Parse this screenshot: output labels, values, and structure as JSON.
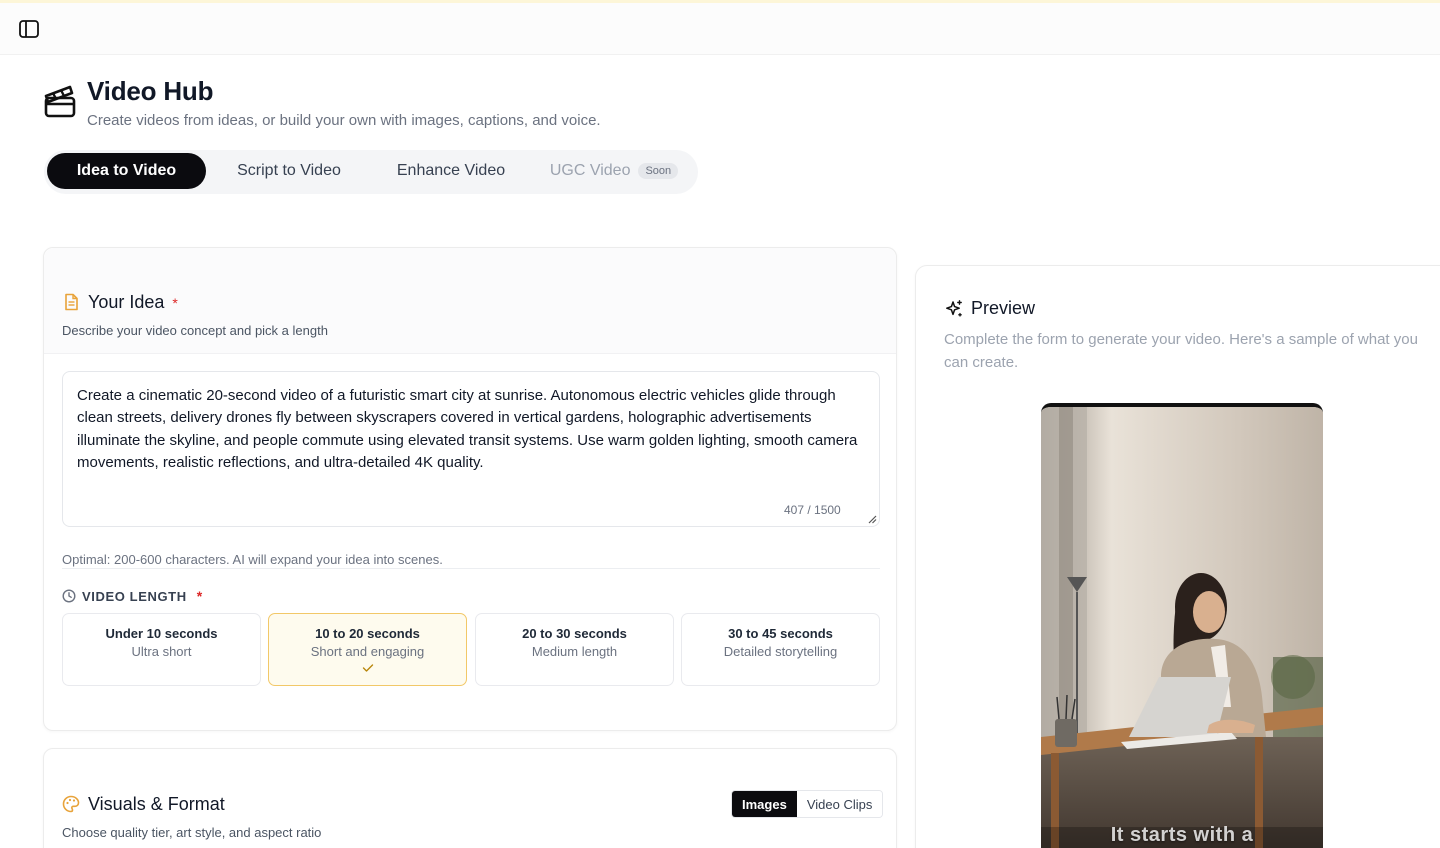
{
  "header": {
    "title": "Video Hub",
    "subtitle": "Create videos from ideas, or build your own with images, captions, and voice."
  },
  "tabs": [
    {
      "label": "Idea to Video",
      "active": true
    },
    {
      "label": "Script to Video",
      "active": false
    },
    {
      "label": "Enhance Video",
      "active": false
    },
    {
      "label": "UGC Video",
      "active": false,
      "badge": "Soon",
      "disabled": true
    }
  ],
  "idea": {
    "title": "Your Idea",
    "required_mark": "*",
    "description": "Describe your video concept and pick a length",
    "text": "Create a cinematic 20-second video of a futuristic smart city at sunrise. Autonomous electric vehicles glide through clean streets, delivery drones fly between skyscrapers covered in vertical gardens, holographic advertisements illuminate the skyline, and people commute using elevated transit systems. Use warm golden lighting, smooth camera movements, realistic reflections, and ultra-detailed 4K quality.",
    "char_count": "407 / 1500",
    "helper": "Optimal: 200-600 characters. AI will expand your idea into scenes.",
    "length_label": "VIDEO LENGTH",
    "length_required_mark": "*",
    "length_options": [
      {
        "title": "Under 10 seconds",
        "desc": "Ultra short",
        "selected": false
      },
      {
        "title": "10 to 20 seconds",
        "desc": "Short and engaging",
        "selected": true
      },
      {
        "title": "20 to 30 seconds",
        "desc": "Medium length",
        "selected": false
      },
      {
        "title": "30 to 45 seconds",
        "desc": "Detailed storytelling",
        "selected": false
      }
    ]
  },
  "visuals": {
    "title": "Visuals & Format",
    "description": "Choose quality tier, art style, and aspect ratio",
    "mode_images": "Images",
    "mode_clips": "Video Clips",
    "active_mode": "Images"
  },
  "preview": {
    "title": "Preview",
    "description": "Complete the form to generate your video. Here's a sample of what you can create.",
    "caption": "It starts with a"
  },
  "colors": {
    "accent": "#f2c868",
    "accent_bg": "#fefbee",
    "active_tab": "#0b0b0f",
    "icon_orange": "#e8a33a",
    "required": "#dc2626"
  },
  "icons": {
    "sidebar_toggle": "sidebar-toggle-icon",
    "header": "clapperboard-icon",
    "idea": "document-icon",
    "length": "clock-icon",
    "visuals": "palette-icon",
    "preview": "sparkles-icon",
    "selected": "check-icon"
  }
}
